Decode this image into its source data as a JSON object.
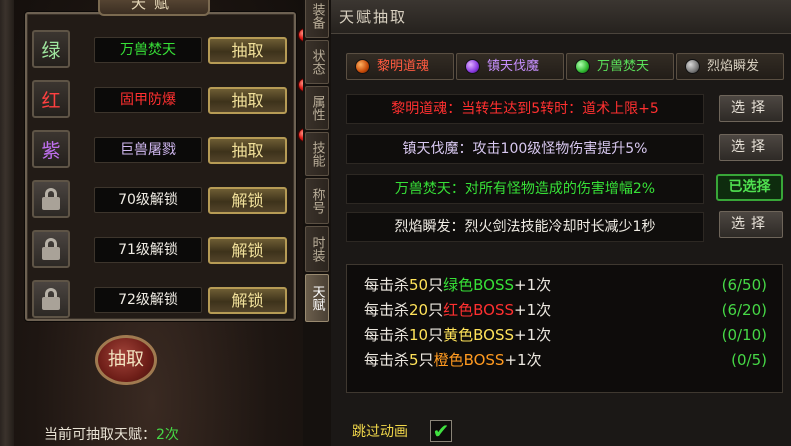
{
  "left_panel": {
    "title": "天赋",
    "talents": [
      {
        "tile_text": "绿",
        "tile_color": "#9fe89f",
        "name": "万兽焚天",
        "name_color": "#37e037",
        "action": "抽取",
        "has_dot": true
      },
      {
        "tile_text": "红",
        "tile_color": "#ff4040",
        "name": "固甲防爆",
        "name_color": "#ff3030",
        "action": "抽取",
        "has_dot": true
      },
      {
        "tile_text": "紫",
        "tile_color": "#c070f0",
        "name": "巨兽屠戮",
        "name_color": "#d0b8f0",
        "action": "抽取",
        "has_dot": true
      },
      {
        "locked": true,
        "name": "70级解锁",
        "name_color": "#f0ece4",
        "action": "解锁"
      },
      {
        "locked": true,
        "name": "71级解锁",
        "name_color": "#f0ece4",
        "action": "解锁"
      },
      {
        "locked": true,
        "name": "72级解锁",
        "name_color": "#f0ece4",
        "action": "解锁"
      }
    ],
    "draw_button": "抽取",
    "remaining_label": "当前可抽取天赋：",
    "remaining_count": "2次"
  },
  "side_tabs": [
    {
      "label": "装备"
    },
    {
      "label": "状态"
    },
    {
      "label": "属性"
    },
    {
      "label": "技能"
    },
    {
      "label": "称号"
    },
    {
      "label": "时装"
    },
    {
      "label": "天赋",
      "active": true
    }
  ],
  "right_panel": {
    "title": "天赋抽取",
    "talent_tabs": [
      {
        "label": "黎明道魂",
        "color": "#ff5a40",
        "gem": "#e05a10"
      },
      {
        "label": "镇天伐魔",
        "color": "#c790ff",
        "gem": "#8a3ae0"
      },
      {
        "label": "万兽焚天",
        "color": "#5ae05a",
        "gem": "#30b830"
      },
      {
        "label": "烈焰瞬发",
        "color": "#d8d0c0",
        "gem": "#7a7a7a"
      }
    ],
    "descriptions": [
      {
        "text": "黎明道魂：当转生达到5转时：道术上限+5",
        "color": "#ff3030",
        "button": "选择"
      },
      {
        "text": "镇天伐魔：攻击100级怪物伤害提升5%",
        "color": "#d8c8f0",
        "button": "选择"
      },
      {
        "text": "万兽焚天：对所有怪物造成的伤害增幅2%",
        "color": "#37e037",
        "selected_label": "已选择"
      },
      {
        "text": "烈焰瞬发：烈火剑法技能冷却时长减少1秒",
        "color": "#f0ece4",
        "button": "选择"
      }
    ],
    "kill_rows": [
      {
        "pre": "每击杀",
        "num": "50",
        "unit": "只",
        "boss": "绿色BOSS",
        "boss_color": "#37e037",
        "suffix": "+1次",
        "progress": "(6/50)"
      },
      {
        "pre": "每击杀",
        "num": "20",
        "unit": "只",
        "boss": "红色BOSS",
        "boss_color": "#ff3030",
        "suffix": "+1次",
        "progress": "(6/20)"
      },
      {
        "pre": "每击杀",
        "num": "10",
        "unit": "只",
        "boss": "黄色BOSS",
        "boss_color": "#ffe35a",
        "suffix": "+1次",
        "progress": "(0/10)"
      },
      {
        "pre": "每击杀",
        "num": "5",
        "unit": "只",
        "boss": "橙色BOSS",
        "boss_color": "#ff9a20",
        "suffix": "+1次",
        "progress": "(0/5)"
      }
    ],
    "skip_animation_label": "跳过动画",
    "skip_animation_checked": "✔"
  }
}
